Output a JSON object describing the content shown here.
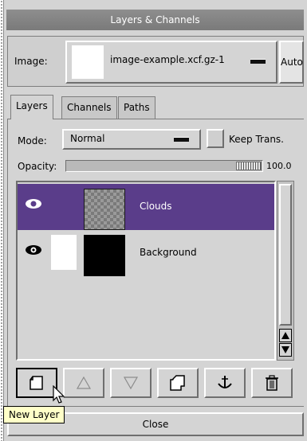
{
  "window": {
    "title": "Layers & Channels"
  },
  "image_selector": {
    "label": "Image:",
    "selected": "image-example.xcf.gz-1",
    "auto_label": "Auto"
  },
  "tabs": [
    {
      "label": "Layers",
      "active": true
    },
    {
      "label": "Channels",
      "active": false
    },
    {
      "label": "Paths",
      "active": false
    }
  ],
  "layers_panel": {
    "mode_label": "Mode:",
    "mode_value": "Normal",
    "keep_trans_label": "Keep Trans.",
    "opacity_label": "Opacity:",
    "opacity_value": "100.0",
    "opacity_level": 1.0,
    "layers": [
      {
        "name": "Clouds",
        "visible": true,
        "selected": true,
        "thumb": "transparent-checker"
      },
      {
        "name": "Background",
        "visible": true,
        "selected": false,
        "thumb": "black"
      }
    ]
  },
  "toolbar": {
    "buttons": [
      {
        "icon": "new-layer-icon",
        "enabled": true
      },
      {
        "icon": "raise-layer-icon",
        "enabled": false
      },
      {
        "icon": "lower-layer-icon",
        "enabled": false
      },
      {
        "icon": "duplicate-layer-icon",
        "enabled": true
      },
      {
        "icon": "anchor-layer-icon",
        "enabled": true
      },
      {
        "icon": "delete-layer-icon",
        "enabled": true
      }
    ]
  },
  "tooltip": {
    "text": "New Layer"
  },
  "close_label": "Close",
  "colors": {
    "selection": "#5a3d8a",
    "titlebar": "#7a7a7a",
    "tooltip_bg": "#ffffc8"
  }
}
